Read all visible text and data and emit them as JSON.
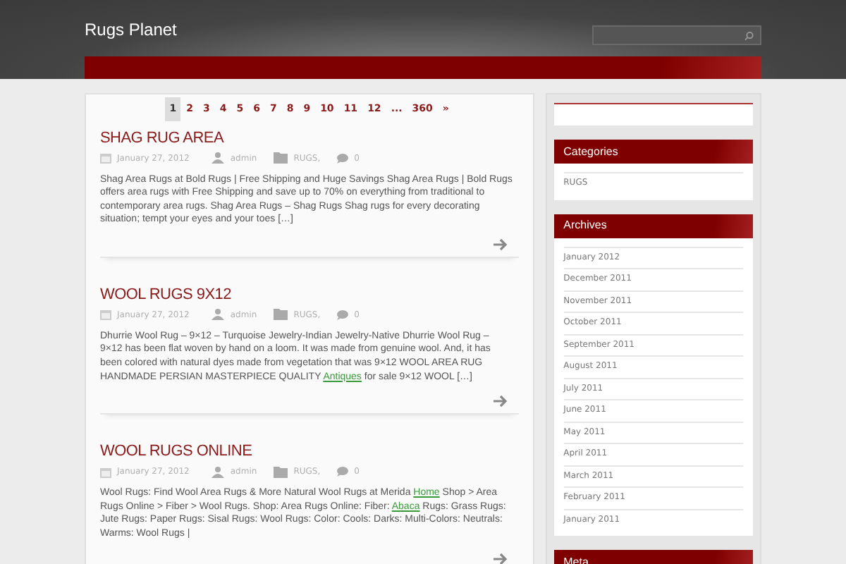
{
  "site": {
    "title": "Rugs Planet"
  },
  "search": {
    "kind": "icon"
  },
  "pagination": [
    {
      "label": "1",
      "selected": true
    },
    {
      "label": "2",
      "selected": false
    },
    {
      "label": "3",
      "selected": false
    },
    {
      "label": "4",
      "selected": false
    },
    {
      "label": "5",
      "selected": false
    },
    {
      "label": "6",
      "selected": false
    },
    {
      "label": "7",
      "selected": false
    },
    {
      "label": "8",
      "selected": false
    },
    {
      "label": "9",
      "selected": false
    },
    {
      "label": "10",
      "selected": false
    },
    {
      "label": "11",
      "selected": false
    },
    {
      "label": "12",
      "selected": false
    },
    {
      "label": "...",
      "selected": false
    },
    {
      "label": "360",
      "selected": false
    },
    {
      "label": "»",
      "selected": false
    }
  ],
  "posts": [
    {
      "title": "SHAG RUG AREA",
      "date": "January 27, 2012",
      "author": "admin",
      "category": "RUGS,",
      "comments": "0",
      "excerpt": [
        {
          "kind": "text",
          "text": "Shag Area Rugs at Bold Rugs | Free Shipping and Huge Savings Shag Area Rugs | Bold Rugs offers area rugs with Free Shipping and save up to 70% on everything from traditional to contemporary area rugs. Shag Area Rugs – Shag Rugs Shag rugs for every decorating situation; tempt your eyes and your toes […]"
        }
      ]
    },
    {
      "title": "WOOL RUGS 9X12",
      "date": "January 27, 2012",
      "author": "admin",
      "category": "RUGS,",
      "comments": "0",
      "excerpt": [
        {
          "kind": "text",
          "text": "Dhurrie Wool Rug – 9×12 – Turquoise Jewelry-Indian Jewelry-Native Dhurrie Wool Rug – 9×12 has been flat woven by hand on a loom. It was made from genuine wool. And, it has been colored with natural dyes made from vegetation that was 9×12 WOOL AREA RUG HANDMADE PERSIAN MASTERPIECE QUALITY "
        },
        {
          "kind": "link",
          "text": "Antiques"
        },
        {
          "kind": "text",
          "text": " for sale 9×12 WOOL […]"
        }
      ]
    },
    {
      "title": "WOOL RUGS ONLINE",
      "date": "January 27, 2012",
      "author": "admin",
      "category": "RUGS,",
      "comments": "0",
      "excerpt": [
        {
          "kind": "text",
          "text": "Wool Rugs: Find Wool Area Rugs & More Natural Wool Rugs at Merida "
        },
        {
          "kind": "link",
          "text": "Home"
        },
        {
          "kind": "text",
          "text": " Shop > Area Rugs Online > Fiber > Wool Rugs. Shop: Area Rugs Online: Fiber: "
        },
        {
          "kind": "link",
          "text": "Abaca"
        },
        {
          "kind": "text",
          "text": " Rugs: Grass Rugs: Jute Rugs: Paper Rugs: Sisal Rugs: Wool Rugs: Color: Cools: Darks: Multi-Colors: Neutrals: Warms: Wool Rugs |"
        }
      ]
    }
  ],
  "sidebar": {
    "widgets": [
      {
        "title": "Categories",
        "items": [
          "RUGS"
        ]
      },
      {
        "title": "Archives",
        "items": [
          "January 2012",
          "December 2011",
          "November 2011",
          "October 2011",
          "September 2011",
          "August 2011",
          "July 2011",
          "June 2011",
          "May 2011",
          "April 2011",
          "March 2011",
          "February 2011",
          "January 2011"
        ]
      },
      {
        "title": "Meta"
      }
    ]
  }
}
